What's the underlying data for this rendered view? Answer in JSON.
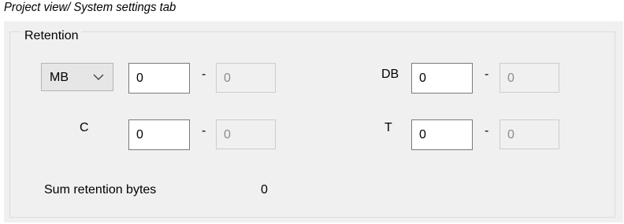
{
  "caption": "Project view/ System settings tab",
  "retention": {
    "title": "Retention",
    "area_select": {
      "selected": "MB"
    },
    "mb_start": "0",
    "mb_end": "0",
    "db_label": "DB",
    "db_start": "0",
    "db_end": "0",
    "c_label": "C",
    "c_start": "0",
    "c_end": "0",
    "t_label": "T",
    "t_start": "0",
    "t_end": "0",
    "dash": "-",
    "sum_label": "Sum retention bytes",
    "sum_value": "0"
  },
  "icons": {
    "combo_arrow": "chevron-down-icon"
  }
}
